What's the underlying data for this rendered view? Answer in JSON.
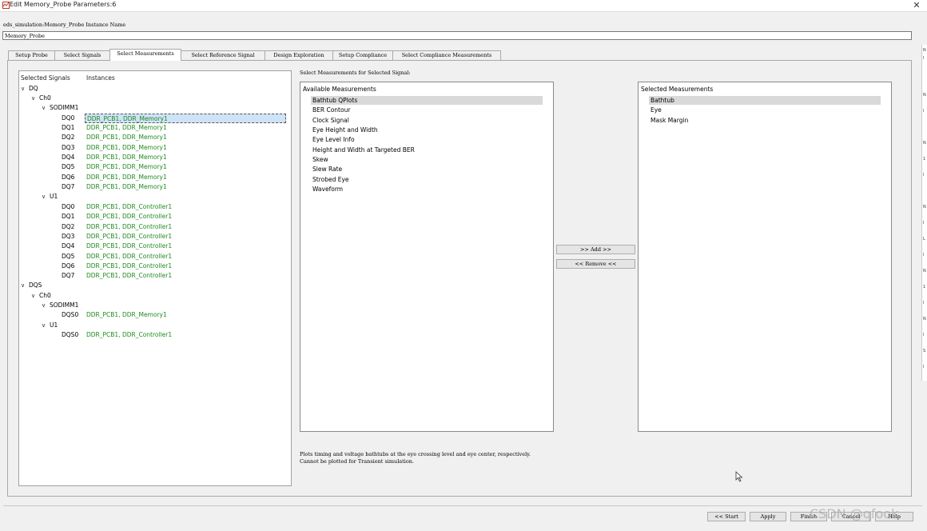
{
  "window": {
    "title": "Edit Memory_Probe Parameters:6",
    "close_glyph": "✕"
  },
  "instance": {
    "label": "eds_simulation:Memory_Probe Instance Name",
    "value": "Memory_Probe"
  },
  "tabs": [
    {
      "label": "Setup Probe"
    },
    {
      "label": "Select Signals"
    },
    {
      "label": "Select Measurements"
    },
    {
      "label": "Select Reference Signal"
    },
    {
      "label": "Design Exploration"
    },
    {
      "label": "Setup Compliance"
    },
    {
      "label": "Select Compliance Measurements"
    }
  ],
  "signals": {
    "col_signals": "Selected Signals",
    "col_instances": "Instances",
    "tree": {
      "dq": "DQ",
      "ch0": "Ch0",
      "sodimm1": "SODIMM1",
      "u1": "U1",
      "dqs": "DQS",
      "dqs_ch0": "Ch0",
      "dqs_sodimm1": "SODIMM1",
      "dqs_u1": "U1"
    },
    "sodimm_rows": [
      {
        "signal": "DQ0",
        "instance": "DDR_PCB1, DDR_Memory1"
      },
      {
        "signal": "DQ1",
        "instance": "DDR_PCB1, DDR_Memory1"
      },
      {
        "signal": "DQ2",
        "instance": "DDR_PCB1, DDR_Memory1"
      },
      {
        "signal": "DQ3",
        "instance": "DDR_PCB1, DDR_Memory1"
      },
      {
        "signal": "DQ4",
        "instance": "DDR_PCB1, DDR_Memory1"
      },
      {
        "signal": "DQ5",
        "instance": "DDR_PCB1, DDR_Memory1"
      },
      {
        "signal": "DQ6",
        "instance": "DDR_PCB1, DDR_Memory1"
      },
      {
        "signal": "DQ7",
        "instance": "DDR_PCB1, DDR_Memory1"
      }
    ],
    "u1_rows": [
      {
        "signal": "DQ0",
        "instance": "DDR_PCB1, DDR_Controller1"
      },
      {
        "signal": "DQ1",
        "instance": "DDR_PCB1, DDR_Controller1"
      },
      {
        "signal": "DQ2",
        "instance": "DDR_PCB1, DDR_Controller1"
      },
      {
        "signal": "DQ3",
        "instance": "DDR_PCB1, DDR_Controller1"
      },
      {
        "signal": "DQ4",
        "instance": "DDR_PCB1, DDR_Controller1"
      },
      {
        "signal": "DQ5",
        "instance": "DDR_PCB1, DDR_Controller1"
      },
      {
        "signal": "DQ6",
        "instance": "DDR_PCB1, DDR_Controller1"
      },
      {
        "signal": "DQ7",
        "instance": "DDR_PCB1, DDR_Controller1"
      }
    ],
    "dqs_sodimm_row": {
      "signal": "DQS0",
      "instance": "DDR_PCB1, DDR_Memory1"
    },
    "dqs_u1_row": {
      "signal": "DQS0",
      "instance": "DDR_PCB1, DDR_Controller1"
    }
  },
  "measurements": {
    "label": "Select Measurements for Selected Signal:",
    "available_header": "Available Measurements",
    "available": [
      "Bathtub QPlots",
      "BER Contour",
      "Clock Signal",
      "Eye Height and Width",
      "Eye Level Info",
      "Height and Width at Targeted BER",
      "Skew",
      "Slew Rate",
      "Strobed Eye",
      "Waveform"
    ],
    "selected_header": "Selected Measurements",
    "selected": [
      "Bathtub",
      "Eye",
      "Mask Margin"
    ],
    "add_label": ">> Add >>",
    "remove_label": "<< Remove <<",
    "description_line1": "Plots timing and voltage bathtubs at the eye crossing level and eye center, respectively.",
    "description_line2": "Cannot be plotted for Transient simulation."
  },
  "footer": {
    "start": "<< Start",
    "apply": "Apply",
    "finish": "Finish",
    "cancel": "Cancel",
    "help": "Help"
  },
  "watermark": "CSDN @qfook"
}
